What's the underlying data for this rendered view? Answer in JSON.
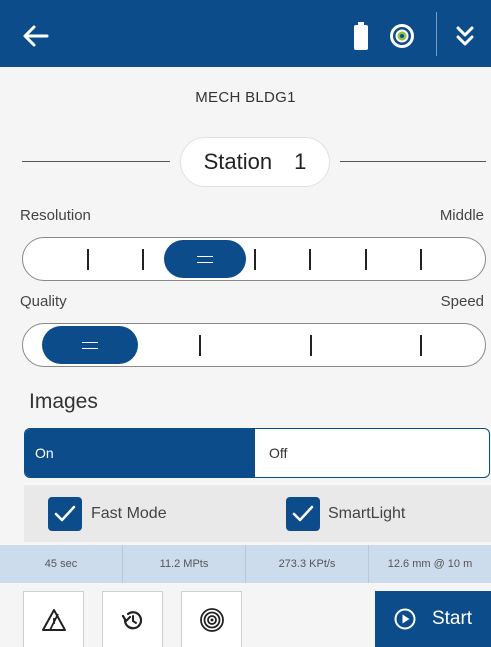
{
  "header": {
    "back_icon": "arrow-left-icon",
    "battery_icon": "battery-icon",
    "target_icon": "target-icon",
    "collapse_icon": "double-chevron-down-icon",
    "background_color": "#0d4c8b"
  },
  "project": {
    "name": "MECH BLDG1"
  },
  "station": {
    "label": "Station",
    "number": "1"
  },
  "resolution": {
    "label": "Resolution",
    "value_label": "Middle",
    "position": 3,
    "steps": 7
  },
  "quality": {
    "label": "Quality",
    "value_label": "Speed",
    "position": 1,
    "steps": 4
  },
  "images": {
    "title": "Images",
    "on_label": "On",
    "off_label": "Off",
    "selected": "On"
  },
  "options": {
    "fast_mode": {
      "label": "Fast Mode",
      "checked": true
    },
    "smartlight": {
      "label": "SmartLight",
      "checked": true
    }
  },
  "stats": {
    "duration": "45 sec",
    "points": "11.2 MPts",
    "rate": "273.3 KPt/s",
    "spacing": "12.6 mm @ 10 m"
  },
  "footer": {
    "buttons": [
      "level-warning-icon",
      "history-icon",
      "target-icon"
    ],
    "start_label": "Start",
    "start_icon": "play-circle-icon"
  },
  "colors": {
    "accent": "#0d4c8b",
    "stats_bg": "#ccdcec",
    "panel_bg": "#e9e9e9"
  }
}
